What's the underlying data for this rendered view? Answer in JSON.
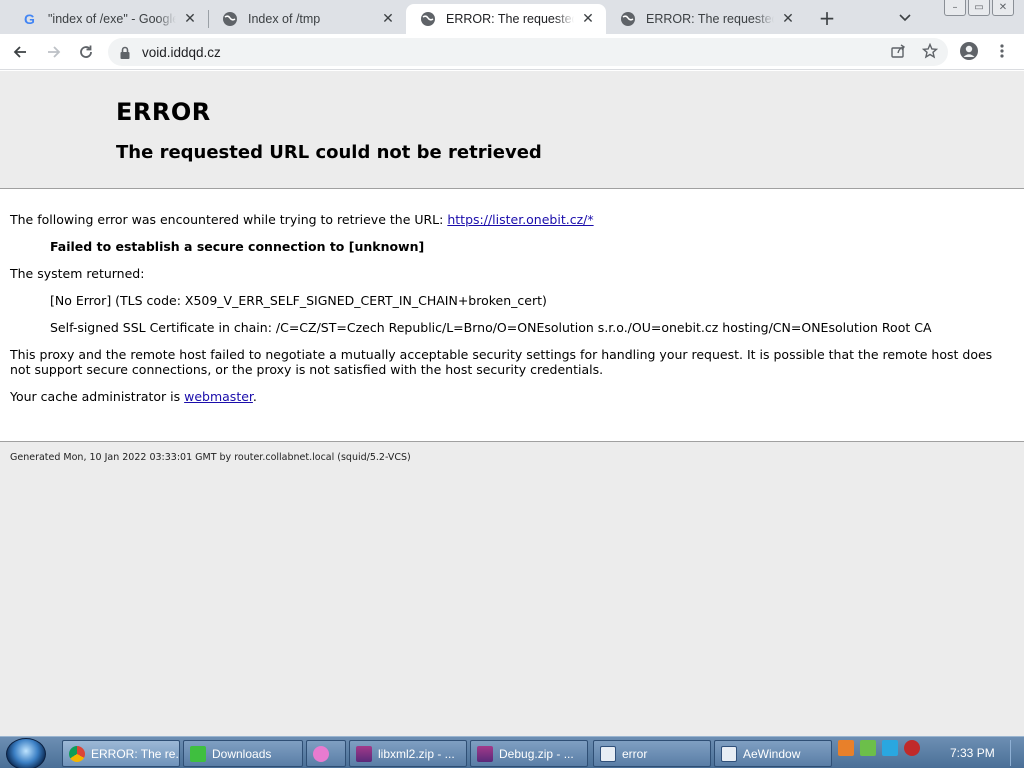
{
  "tabs": [
    {
      "title": "\"index of /exe\" - Google",
      "icon": "google-icon",
      "active": false
    },
    {
      "title": "Index of /tmp",
      "icon": "globe-icon",
      "active": false
    },
    {
      "title": "ERROR: The requested URL",
      "icon": "globe-icon",
      "active": true
    },
    {
      "title": "ERROR: The requested URL",
      "icon": "globe-icon",
      "active": false
    }
  ],
  "tabs_ui": {
    "new_tab": "+",
    "close": "✕"
  },
  "window_controls": {
    "minimize": "–",
    "restore": "▭",
    "close": "✕"
  },
  "toolbar": {
    "url": "void.iddqd.cz"
  },
  "page": {
    "heading": "ERROR",
    "subheading": "The requested URL could not be retrieved",
    "intro": "The following error was encountered while trying to retrieve the URL: ",
    "intro_link": "https://lister.onebit.cz/*",
    "error_detail": "Failed to establish a secure connection to [unknown]",
    "system_returned_label": "The system returned:",
    "tls_code": "[No Error] (TLS code: X509_V_ERR_SELF_SIGNED_CERT_IN_CHAIN+broken_cert)",
    "cert_chain": "Self-signed SSL Certificate in chain: /C=CZ/ST=Czech Republic/L=Brno/O=ONEsolution s.r.o./OU=onebit.cz hosting/CN=ONEsolution Root CA",
    "explanation": "This proxy and the remote host failed to negotiate a mutually acceptable security settings for handling your request. It is possible that the remote host does not support secure connections, or the proxy is not satisfied with the host security credentials.",
    "admin_prefix": "Your cache administrator is ",
    "admin_link": "webmaster",
    "admin_suffix": ".",
    "footer": "Generated Mon, 10 Jan 2022 03:33:01 GMT by router.collabnet.local (squid/5.2-VCS)"
  },
  "taskbar": {
    "items": [
      {
        "label": "ERROR: The re...",
        "icon": "chrome-icon",
        "active": true
      },
      {
        "label": "Downloads",
        "icon": "download-folder-icon",
        "active": false
      },
      {
        "label": "",
        "icon": "media-player-icon",
        "active": false
      },
      {
        "label": "libxml2.zip - ...",
        "icon": "winrar-icon",
        "active": false
      },
      {
        "label": "Debug.zip - ...",
        "icon": "winrar-icon",
        "active": false
      },
      {
        "label": "error",
        "icon": "window-app-icon",
        "active": false
      },
      {
        "label": "AeWindow",
        "icon": "window-app-icon",
        "active": false
      }
    ],
    "clock": "7:33 PM"
  },
  "colors": {
    "tabstrip_bg": "#dee1e6",
    "page_header_bg": "#ececec",
    "link": "#1a0dab",
    "taskbar_bg": "#5a7ea6"
  }
}
